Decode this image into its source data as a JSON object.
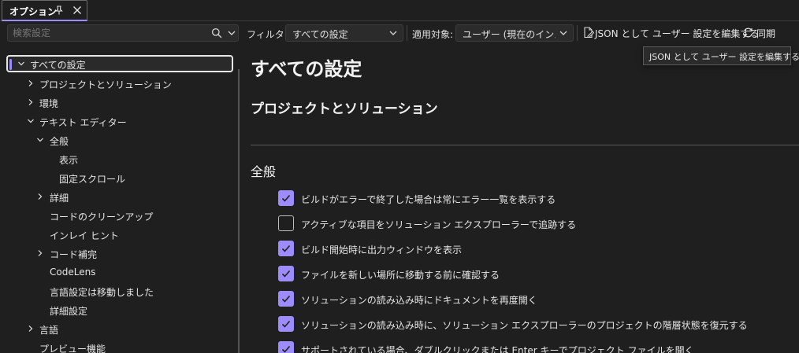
{
  "colors": {
    "accent": "#9d8cff",
    "background": "#1f1f1f"
  },
  "tab": {
    "title": "オプション",
    "pin_icon": "pin-icon",
    "close_icon": "close-icon"
  },
  "toolbar": {
    "search_placeholder": "検索設定",
    "filter_label": "フィルター:",
    "filter_value": "すべての設定",
    "apply_label": "適用対象:",
    "apply_value": "ユーザー (現在のインストール)",
    "json_button_label": "JSON として ユーザー 設定を編集する",
    "sync_label": "同期"
  },
  "tooltip": {
    "text": "JSON として ユーザー 設定を編集する"
  },
  "tree": {
    "items": [
      {
        "label": "すべての設定",
        "expanded": true,
        "selected": true
      },
      {
        "label": "プロジェクトとソリューション",
        "expanded": false
      },
      {
        "label": "環境",
        "expanded": false
      },
      {
        "label": "テキスト エディター",
        "expanded": true
      },
      {
        "label": "全般",
        "expanded": true
      },
      {
        "label": "表示"
      },
      {
        "label": "固定スクロール"
      },
      {
        "label": "詳細",
        "expanded": false
      },
      {
        "label": "コードのクリーンアップ"
      },
      {
        "label": "インレイ ヒント"
      },
      {
        "label": "コード補完",
        "expanded": false
      },
      {
        "label": "CodeLens"
      },
      {
        "label": "言語設定は移動しました"
      },
      {
        "label": "詳細設定"
      },
      {
        "label": "言語",
        "expanded": false
      },
      {
        "label": "プレビュー機能"
      }
    ]
  },
  "main": {
    "page_title": "すべての設定",
    "section_title": "プロジェクトとソリューション",
    "sub_title": "全般",
    "options": [
      {
        "label": "ビルドがエラーで終了した場合は常にエラー一覧を表示する",
        "checked": true
      },
      {
        "label": "アクティブな項目をソリューション エクスプローラーで追跡する",
        "checked": false
      },
      {
        "label": "ビルド開始時に出力ウィンドウを表示",
        "checked": true
      },
      {
        "label": "ファイルを新しい場所に移動する前に確認する",
        "checked": true
      },
      {
        "label": "ソリューションの読み込み時にドキュメントを再度開く",
        "checked": true
      },
      {
        "label": "ソリューションの読み込み時に、ソリューション エクスプローラーのプロジェクトの階層状態を復元する",
        "checked": true
      },
      {
        "label": "サポートされている場合、ダブルクリックまたは Enter キーでプロジェクト ファイルを開く",
        "checked": true
      }
    ]
  }
}
